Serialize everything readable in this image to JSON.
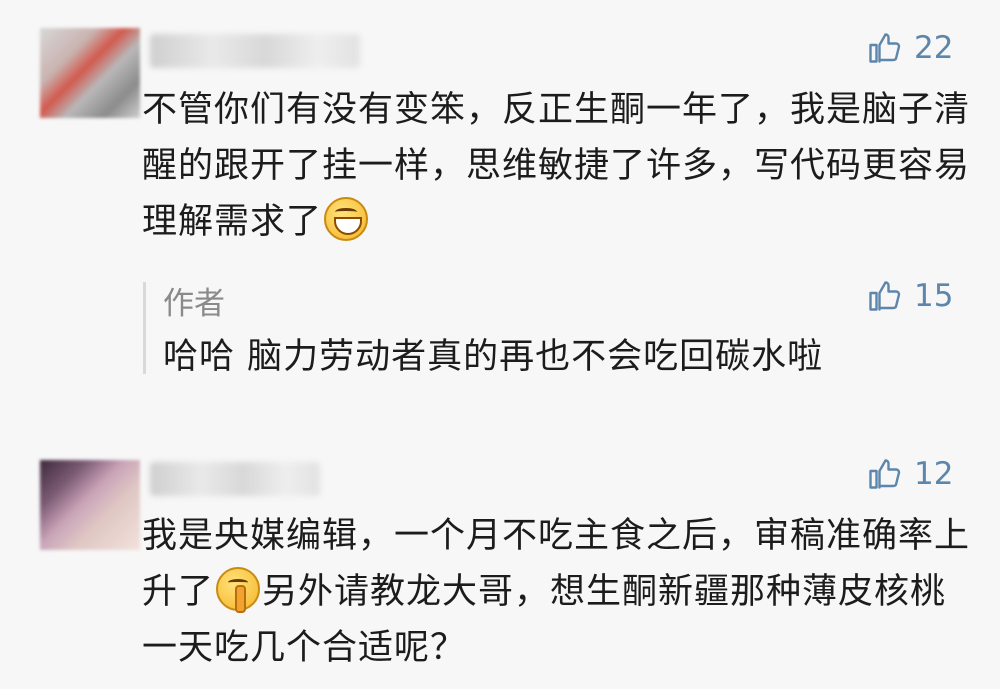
{
  "comments": [
    {
      "likes": "22",
      "text_before_emoji": "不管你们有没有变笨，反正生酮一年了，我是脑子清醒的跟开了挂一样，思维敏捷了许多，写代码更容易理解需求了",
      "emoji": "grinning-face-icon",
      "reply": {
        "author": "作者",
        "likes": "15",
        "text": "哈哈 脑力劳动者真的再也不会吃回碳水啦"
      }
    },
    {
      "likes": "12",
      "text_before_emoji": "我是央媒编辑，一个月不吃主食之后，审稿准确率上升了",
      "emoji": "shushing-face-icon",
      "text_after_emoji": "另外请教龙大哥，想生酮新疆那种薄皮核桃一天吃几个合适呢？"
    }
  ],
  "colors": {
    "like": "#5d86ad",
    "text": "#1c1c1c",
    "reply_author": "#8a8a8a",
    "background": "#f7f7f7"
  }
}
